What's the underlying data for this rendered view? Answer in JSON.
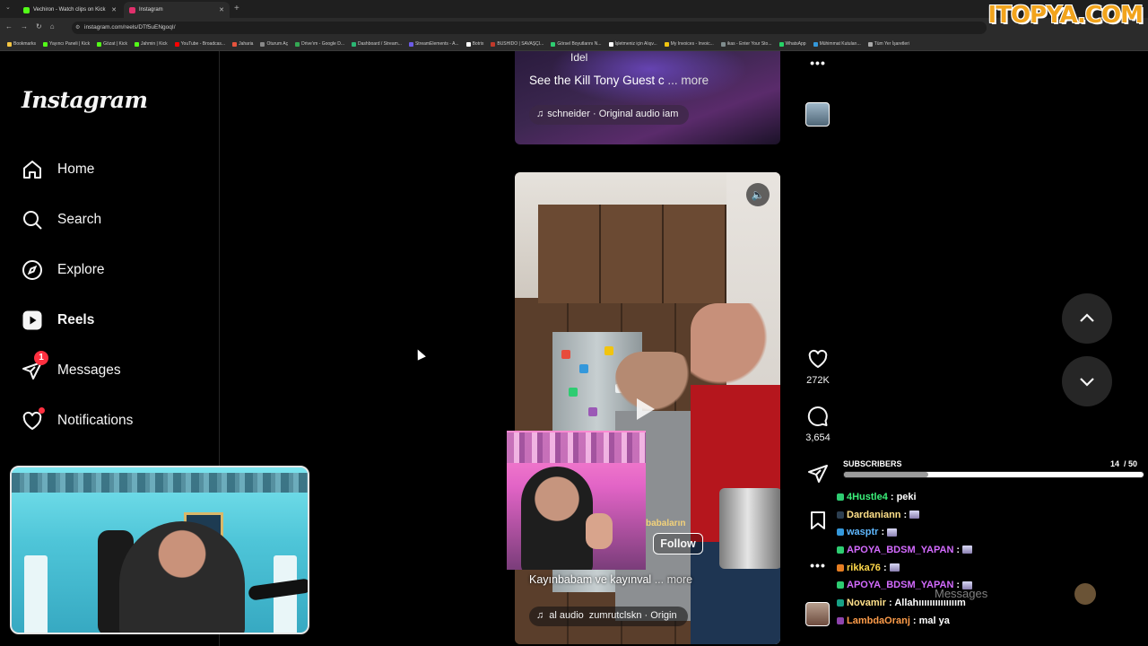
{
  "browser": {
    "tabs": [
      {
        "label": "Vechiron - Watch clips on Kick",
        "fav_color": "#53fc18",
        "active": false
      },
      {
        "label": "Instagram",
        "fav_color": "#e1306c",
        "active": true
      }
    ],
    "url": "instagram.com/reels/DTf5uENgoqI/",
    "bookmarks": [
      {
        "label": "Bookmarks",
        "color": "#f4c542"
      },
      {
        "label": "Yayıncı Paneli | Kick",
        "color": "#53fc18"
      },
      {
        "label": "Gözat | Kick",
        "color": "#53fc18"
      },
      {
        "label": "Jahmin | Kick",
        "color": "#53fc18"
      },
      {
        "label": "YouTube - Broadcas...",
        "color": "#ff0000"
      },
      {
        "label": "Jaharia",
        "color": "#e5533d"
      },
      {
        "label": "Oturum Aç",
        "color": "#888888"
      },
      {
        "label": "Drive'ım - Google D...",
        "color": "#34a853"
      },
      {
        "label": "Dashboard / Stream...",
        "color": "#2bb673"
      },
      {
        "label": "StreamElements - A...",
        "color": "#6c5ce7"
      },
      {
        "label": "Botrix",
        "color": "#ffffff"
      },
      {
        "label": "BUSHIDO | SAVAŞÇI...",
        "color": "#c0392b"
      },
      {
        "label": "Görsel Boyutlarını N...",
        "color": "#2ecc71"
      },
      {
        "label": "İşletmeniz için Alışv...",
        "color": "#ffffff"
      },
      {
        "label": "My Invoices - Invoic...",
        "color": "#f1c40f"
      },
      {
        "label": "ikas - Enter Your Sto...",
        "color": "#7f8c8d"
      },
      {
        "label": "WhatsApp",
        "color": "#25d366"
      },
      {
        "label": "Mühimmat Kutuları...",
        "color": "#3498db"
      },
      {
        "label": "Tüm Yer İşaretleri",
        "color": "#aaaaaa"
      }
    ],
    "watermark": "ITOPYA.COM"
  },
  "sidebar": {
    "logo": "Instagram",
    "items": [
      {
        "label": "Home",
        "icon": "home-icon"
      },
      {
        "label": "Search",
        "icon": "search-icon"
      },
      {
        "label": "Explore",
        "icon": "explore-icon"
      },
      {
        "label": "Reels",
        "icon": "reels-icon",
        "active": true
      },
      {
        "label": "Messages",
        "icon": "messages-icon",
        "badge": "1"
      },
      {
        "label": "Notifications",
        "icon": "heart-icon",
        "dot": true
      }
    ]
  },
  "reels": [
    {
      "caption": "See the Kill Tony Guest c",
      "more": "... more",
      "top_text": "Idel",
      "audio": "schneider · Original audio  iam"
    },
    {
      "caption": "Kayınbabam ve kayınval",
      "more": "... more",
      "audio_a": "al audio",
      "audio_b": "zumrutclskn · Origin",
      "follow": "Follow",
      "overlay_text": "babaların",
      "likes": "272K",
      "comments": "3,654"
    }
  ],
  "stream_overlay": {
    "subs_label": "SUBSCRIBERS",
    "subs_count": "14",
    "subs_goal": "/ 50",
    "subs_progress": 0.28,
    "chat": [
      {
        "user": "4Hustle4",
        "color": "#3bf07a",
        "text": ": peki",
        "badge": "#2ecc71"
      },
      {
        "user": "Dardaniann",
        "color": "#ffe08a",
        "text": ":",
        "badge": "#2c3e50"
      },
      {
        "user": "wasptr",
        "color": "#5fb8ff",
        "text": ":",
        "badge": "#3498db"
      },
      {
        "user": "APOYA_BDSM_YAPAN",
        "color": "#d46bff",
        "text": ":",
        "badge": "#2ecc71"
      },
      {
        "user": "rikka76",
        "color": "#ffd84a",
        "text": ":",
        "badge": "#e67e22"
      },
      {
        "user": "APOYA_BDSM_YAPAN",
        "color": "#d46bff",
        "text": ":",
        "badge": "#2ecc71"
      },
      {
        "user": "Novamir",
        "color": "#ffe08a",
        "text": ": Allahıııııııııııııım",
        "badge": "#16a085"
      },
      {
        "user": "LambdaOranj",
        "color": "#ff9d4a",
        "text": ": mal ya",
        "badge": "#8e44ad"
      }
    ],
    "messages_ghost": "Messages"
  }
}
